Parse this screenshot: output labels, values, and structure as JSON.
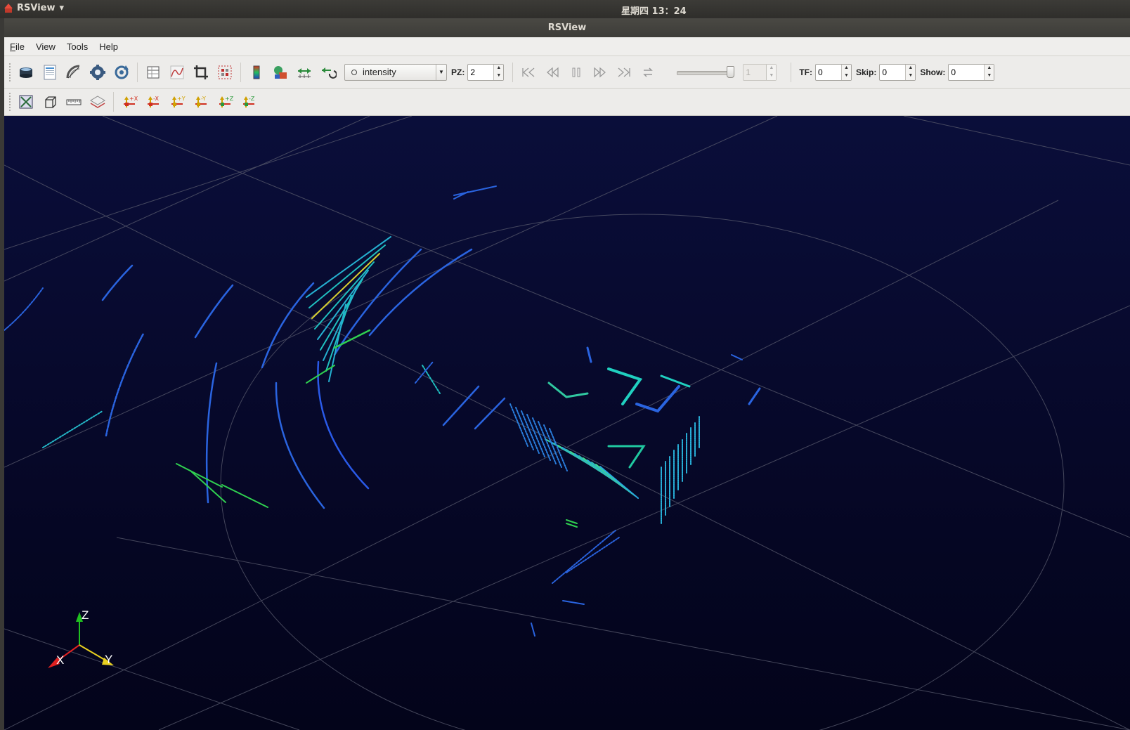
{
  "top_panel": {
    "app_name": "RSView",
    "app_menu_arrow": "▾",
    "clock": "星期四 13：24"
  },
  "window": {
    "title": "RSView"
  },
  "menubar": {
    "items": [
      "File",
      "View",
      "Tools",
      "Help"
    ]
  },
  "toolbar1": {
    "file_buttons": [
      "open-sensor-stream-icon",
      "open-pcap-icon",
      "calibration-icon",
      "sensor-config-icon",
      "reset-config-icon"
    ],
    "view_buttons": [
      "spreadsheet-icon",
      "graph-icon",
      "crop-icon",
      "selection-grid-icon"
    ],
    "color_buttons": [
      "color-legend-icon",
      "color-map-icon",
      "measure-icon",
      "transform-icon"
    ],
    "color_by": {
      "selected": "intensity",
      "options": [
        "intensity"
      ]
    },
    "pz": {
      "label": "PZ:",
      "value": "2"
    },
    "playback_buttons": [
      "first-frame-icon",
      "rewind-icon",
      "pause-icon",
      "fast-forward-icon",
      "last-frame-icon",
      "loop-icon"
    ],
    "frame_slider": {
      "level_fraction": 1.0
    },
    "frame_spin": {
      "value": "1",
      "disabled": true
    },
    "tf": {
      "label": "TF:",
      "value": "0"
    },
    "skip": {
      "label": "Skip:",
      "value": "0"
    },
    "show": {
      "label": "Show:",
      "value": "0"
    }
  },
  "toolbar2": {
    "view_buttons": [
      "reset-camera-icon",
      "perspective-view-icon",
      "ruler-icon",
      "layers-icon"
    ],
    "axis_views": [
      "+X",
      "-X",
      "+Y",
      "-Y",
      "+Z",
      "-Z"
    ]
  },
  "viewport": {
    "background": "#050623",
    "orientation_axes": {
      "x_label": "X",
      "y_label": "Y",
      "z_label": "Z"
    },
    "colors": {
      "x_axis": "#e02020",
      "y_axis": "#e8d020",
      "z_axis": "#20c020",
      "grid": "#5a5c6a"
    }
  }
}
